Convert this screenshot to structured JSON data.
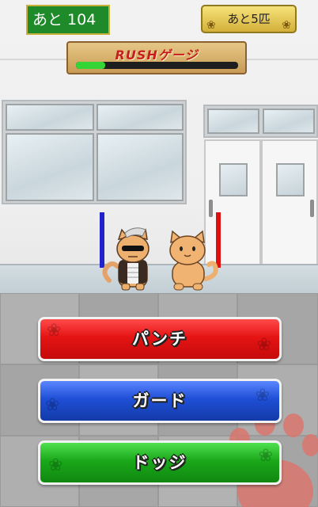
{
  "hud": {
    "remaining_hits": "あと 104",
    "remaining_cats": "あと5匹",
    "rush_label": "RUSHゲージ",
    "rush_progress": 0.18
  },
  "buttons": {
    "punch": "パンチ",
    "guard": "ガード",
    "dodge": "ドッジ"
  },
  "colors": {
    "punch": "#e51414",
    "guard": "#1f4fd6",
    "dodge": "#1aa81a",
    "rush_fill": "#35d535"
  }
}
